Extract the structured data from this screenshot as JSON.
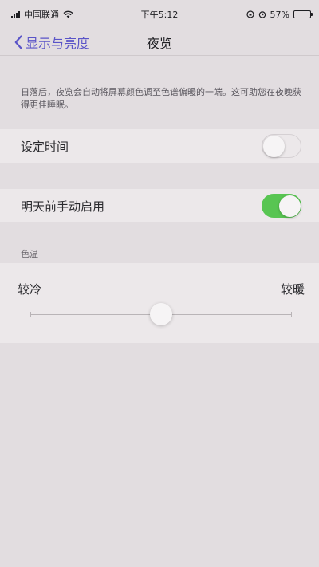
{
  "status_bar": {
    "carrier": "中国联通",
    "time": "下午5:12",
    "battery_percent": "57%",
    "battery_level": 0.57,
    "icons": [
      "signal-icon",
      "wifi-icon",
      "lock-rotation-icon",
      "alarm-icon",
      "battery-icon"
    ]
  },
  "nav": {
    "back_label": "显示与亮度",
    "title": "夜览",
    "accent_color": "#5a54c8"
  },
  "description": "日落后，夜览会自动将屏幕颜色调至色谱偏暖的一端。这可助您在夜晚获得更佳睡眠。",
  "scheduled": {
    "label": "设定时间",
    "enabled": false
  },
  "manual": {
    "label": "明天前手动启用",
    "enabled": true,
    "on_color": "#58c552"
  },
  "color_temperature": {
    "header": "色温",
    "cool_label": "较冷",
    "warm_label": "较暖",
    "value": 0.5
  }
}
